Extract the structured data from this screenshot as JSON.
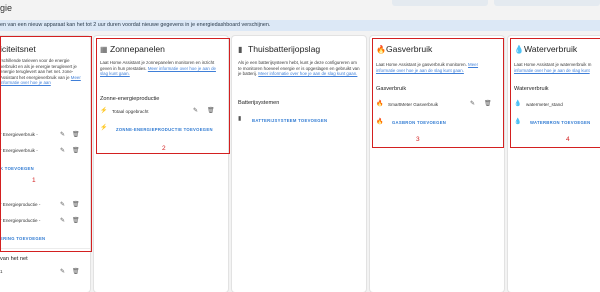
{
  "page": {
    "title": "gie"
  },
  "banner": {
    "text": "en van een nieuw apparaat kan het tot 2 uur duren voordat nieuwe gegevens in je energiedashboard verschijnen."
  },
  "grid": {
    "title": "iciteitsnet",
    "desc": "rschillende tarieven voor de energie verbruikt en als je energie teruglevert je energie teruglevert aan het net. zone-Assistant het energieverbruik van je",
    "desc_link": "Meer informatie over hoe je aan",
    "rows": [
      "r Energieverbruik -",
      "r Energieverbruik -",
      "r Energieproductie -",
      "r Energieproductie -"
    ],
    "add_consumption": "K TOEVOEGEN",
    "add_return": "ERING TOEVOEGEN",
    "bottom_label": "van het net",
    "bottom_row": "1",
    "number": "1"
  },
  "solar": {
    "title": "Zonnepanelen",
    "desc": "Laat Home Assistant je zonnepanelen monitoren en inzicht geven in hun prestaties.",
    "desc_link": "Meer informatie over hoe je aan de slag kunt gaan.",
    "section": "Zonne-energieproductie",
    "row": "Totaal opgebracht",
    "add": "ZONNE-ENERGIEPRODUCTIE TOEVOEGEN",
    "number": "2"
  },
  "battery": {
    "title": "Thuisbatterijopslag",
    "desc": "Als je een batterijsysteem hebt, kunt je deze configureren om te monitoren hoeveel energie er is opgeslagen en gebruikt van je batterij.",
    "desc_link": "Meer informatie over hoe je aan de slag kunt gaan.",
    "section": "Batterijsystemen",
    "add": "BATTERIJSYSTEEM TOEVOEGEN"
  },
  "gas": {
    "title": "Gasverbruik",
    "desc": "Laat Home Assistant je gasverbruik monitoren.",
    "desc_link": "Meer informatie over hoe je aan de slag kunt gaan.",
    "section": "Gasverbruik",
    "row": "SmartMeter Gasverbruik",
    "add": "GASBRON TOEVOEGEN",
    "number": "3"
  },
  "water": {
    "title": "Waterverbruik",
    "desc": "Laat Home Assistant je waterverbruik m",
    "desc_link": "informatie over hoe je aan de slag kunt",
    "section": "Waterverbruik",
    "row": "watermeter_stand",
    "add": "WATERBRON TOEVOEGEN",
    "number": "4"
  },
  "colors": {
    "accent": "#2f7ad2",
    "highlight": "#d32020",
    "banner": "#dce8f6"
  }
}
